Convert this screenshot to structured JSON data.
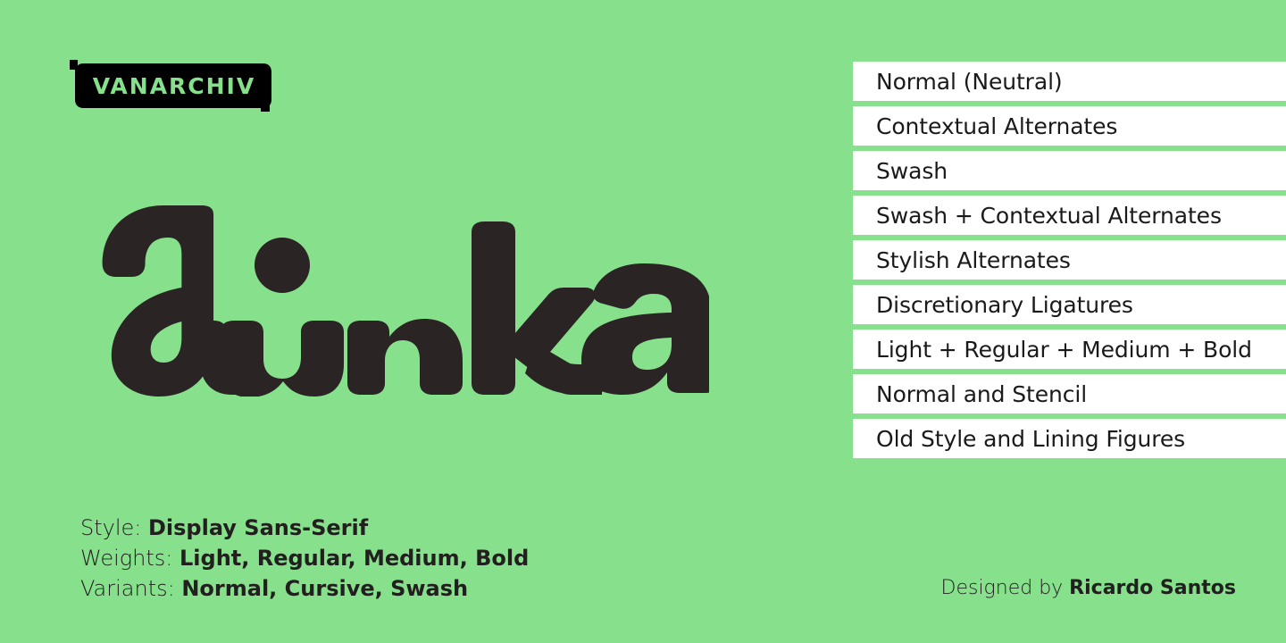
{
  "colors": {
    "background_green": "#87e08c",
    "wordmark_dark": "#2b2424",
    "badge_black": "#000000",
    "row_white": "#ffffff",
    "text_dark": "#22201f"
  },
  "logo": {
    "text": "VANARCHIV",
    "shape": "notched-rounded-badge"
  },
  "wordmark": {
    "text": "Linka",
    "style": "heavy rounded script with swash L"
  },
  "features": {
    "items": [
      {
        "label": "Normal (Neutral)"
      },
      {
        "label": "Contextual Alternates"
      },
      {
        "label": "Swash"
      },
      {
        "label": "Swash + Contextual Alternates"
      },
      {
        "label": "Stylish Alternates"
      },
      {
        "label": "Discretionary Ligatures"
      },
      {
        "label": "Light + Regular + Medium + Bold"
      },
      {
        "label": "Normal and Stencil"
      },
      {
        "label": "Old Style and Lining Figures"
      }
    ]
  },
  "meta": {
    "rows": [
      {
        "key": "Style: ",
        "value": "Display Sans-Serif"
      },
      {
        "key": "Weights: ",
        "value": "Light, Regular, Medium, Bold"
      },
      {
        "key": "Variants: ",
        "value": "Normal, Cursive, Swash"
      }
    ]
  },
  "credit": {
    "prefix": "Designed by ",
    "name": "Ricardo Santos"
  }
}
